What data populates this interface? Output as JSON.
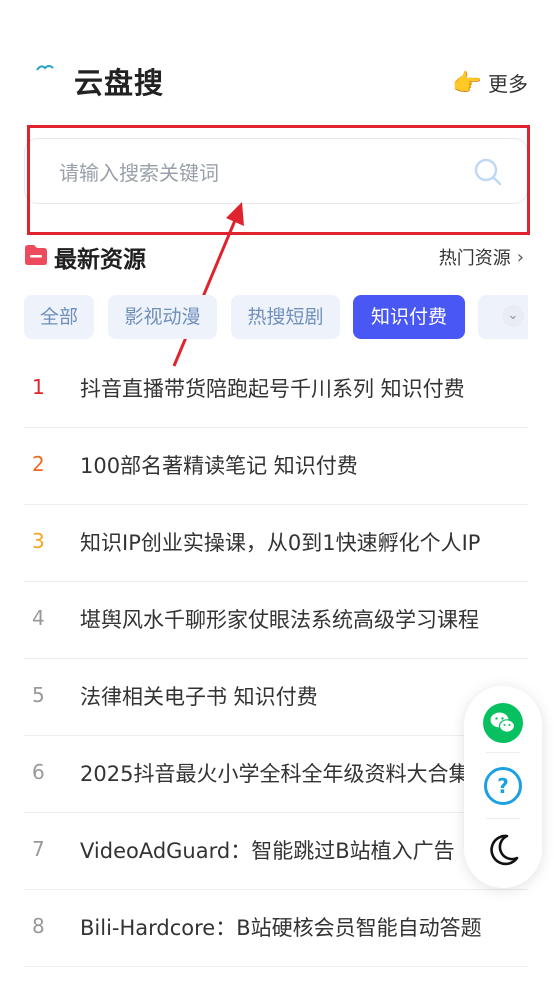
{
  "header": {
    "title": "云盘搜",
    "more_label": "更多",
    "more_icon": "pointing-hand-icon"
  },
  "search": {
    "placeholder": "请输入搜索关键词",
    "value": ""
  },
  "section": {
    "title": "最新资源",
    "hot_link": "热门资源"
  },
  "tabs": [
    {
      "label": "全部",
      "active": false
    },
    {
      "label": "影视动漫",
      "active": false
    },
    {
      "label": "热搜短剧",
      "active": false
    },
    {
      "label": "知识付费",
      "active": true
    }
  ],
  "list": [
    {
      "rank": "1",
      "title": "抖音直播带货陪跑起号千川系列 知识付费"
    },
    {
      "rank": "2",
      "title": "100部名著精读笔记 知识付费"
    },
    {
      "rank": "3",
      "title": "知识IP创业实操课，从0到1快速孵化个人IP"
    },
    {
      "rank": "4",
      "title": "堪舆风水千聊形家仗眼法系统高级学习课程"
    },
    {
      "rank": "5",
      "title": "法律相关电子书 知识付费"
    },
    {
      "rank": "6",
      "title": "2025抖音最火小学全科全年级资料大合集"
    },
    {
      "rank": "7",
      "title": "VideoAdGuard：智能跳过B站植入广告"
    },
    {
      "rank": "8",
      "title": "Bili-Hardcore：B站硬核会员智能自动答题"
    }
  ],
  "colors": {
    "accent": "#4957f5",
    "highlight": "#e0242e",
    "rank1": "#e0242e",
    "rank2": "#f06a25",
    "rank3": "#f5a623",
    "wechat": "#07c160",
    "help": "#1ba1e2"
  },
  "float_icons": [
    "wechat-icon",
    "help-icon",
    "moon-icon"
  ]
}
